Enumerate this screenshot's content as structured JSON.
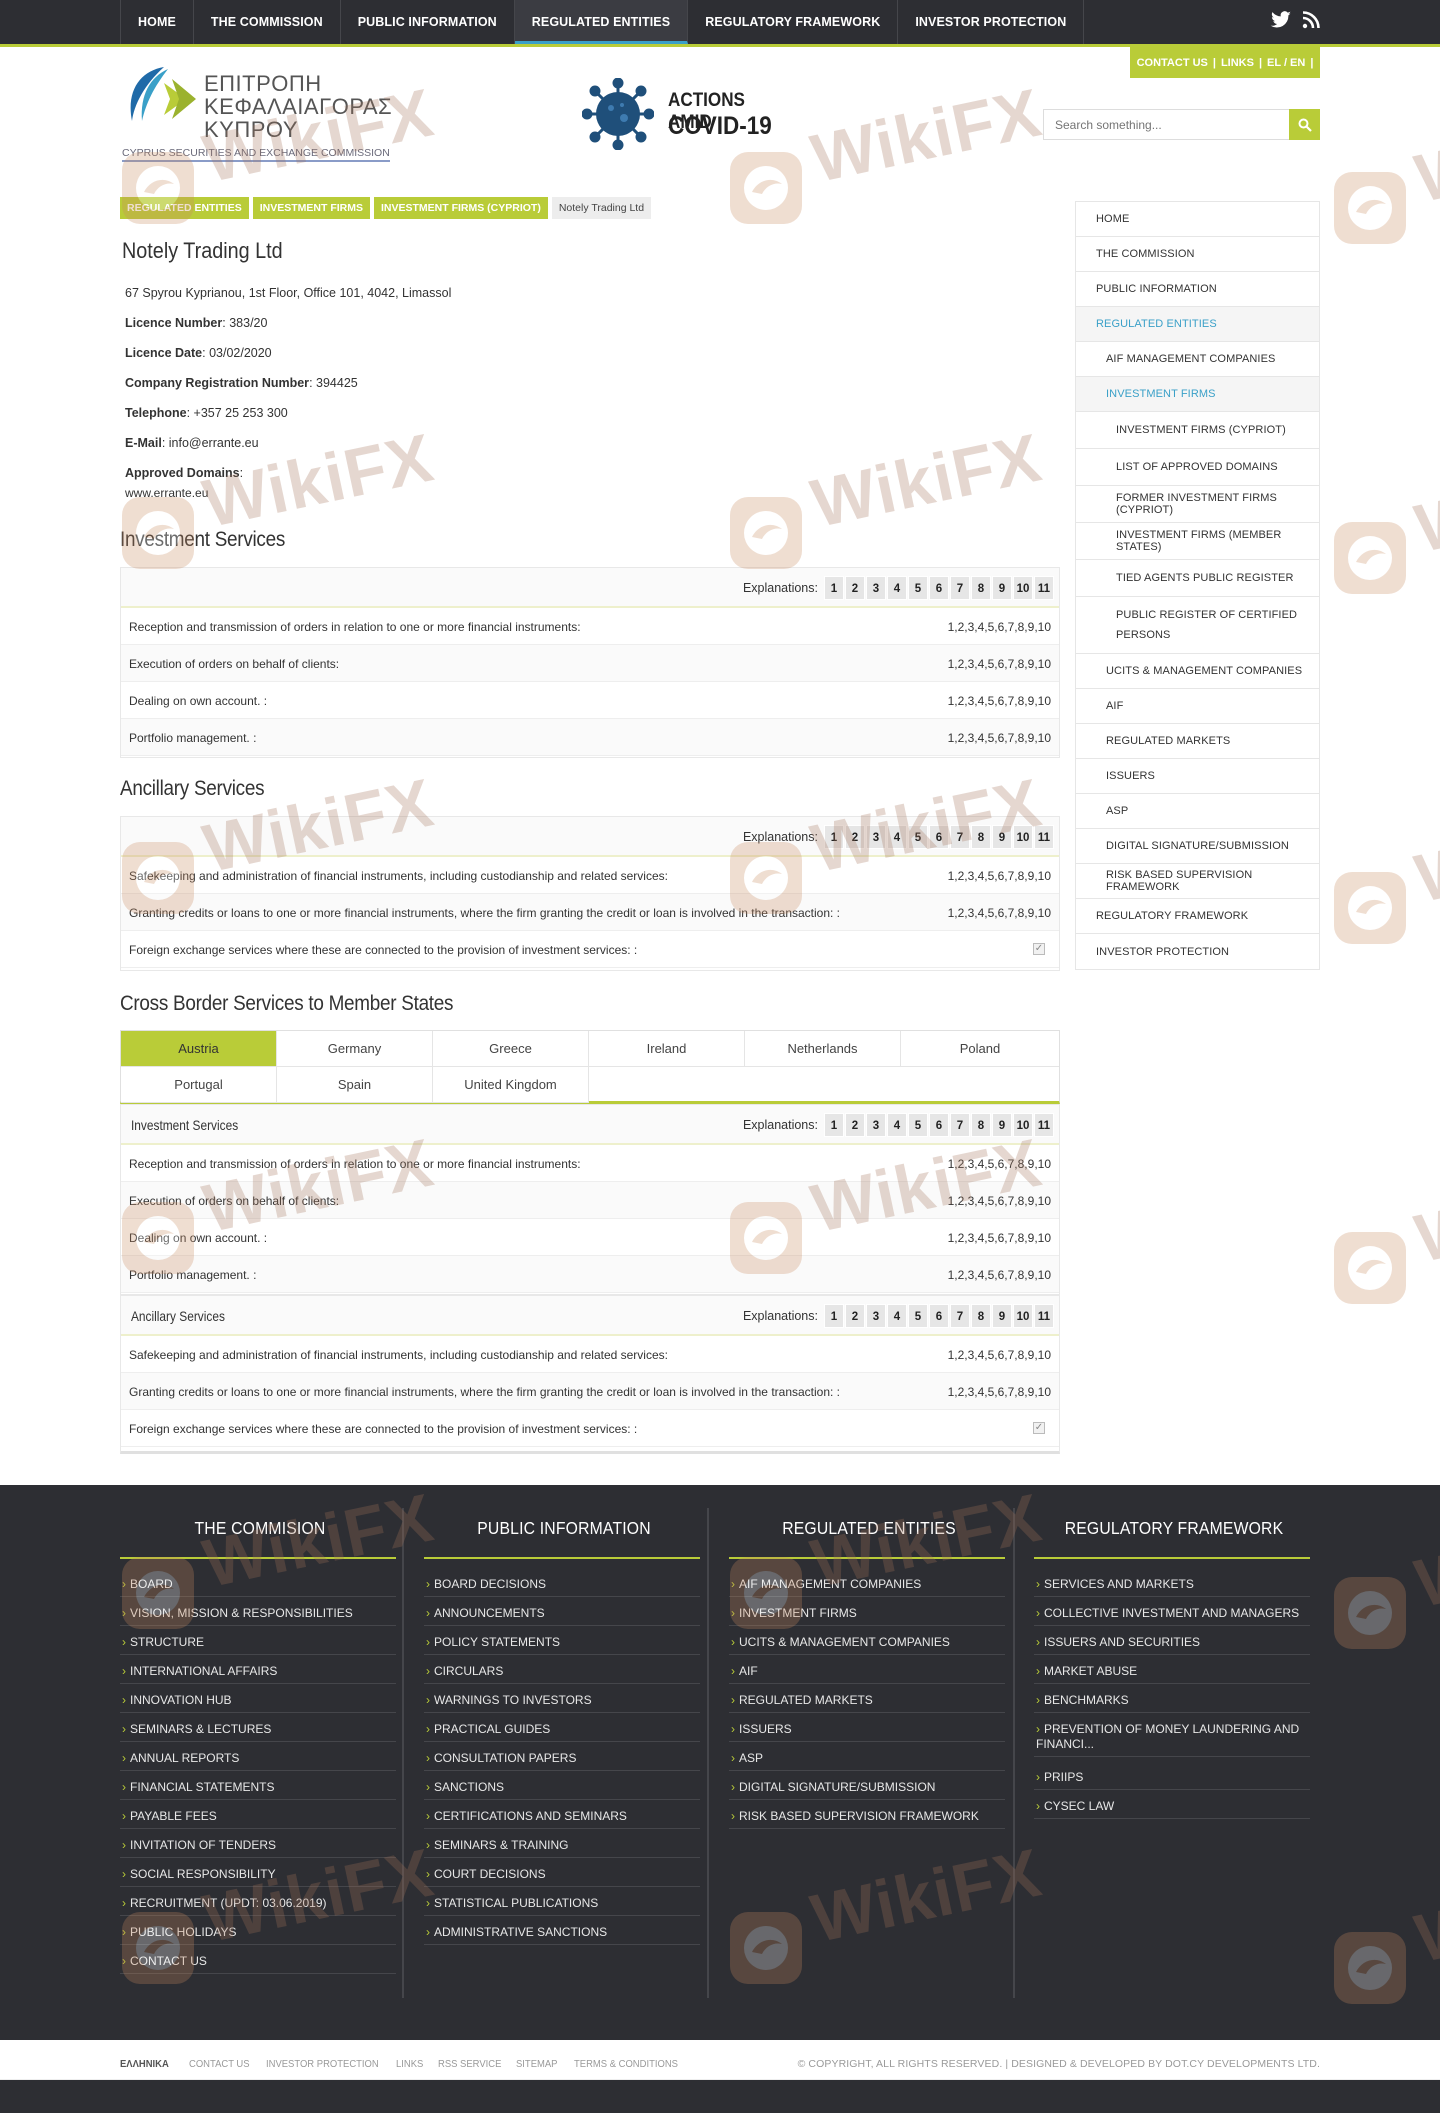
{
  "nav": [
    "HOME",
    "THE COMMISSION",
    "PUBLIC INFORMATION",
    "REGULATED ENTITIES",
    "REGULATORY FRAMEWORK",
    "INVESTOR PROTECTION"
  ],
  "contact_bar": {
    "contact": "CONTACT US",
    "sep1": "|",
    "links": "LINKS",
    "sep2": "|",
    "lang": "EL / EN",
    "sep3": "|"
  },
  "logo": {
    "line1": "ΕΠΙΤΡΟΠΗ",
    "line2": "ΚΕΦΑΛΑΙΑΓΟΡΑΣ",
    "line3": "ΚΥΠΡΟΥ",
    "english": "CYPRUS SECURITIES AND EXCHANGE COMMISSION"
  },
  "covid": {
    "line1": "ACTIONS AMID",
    "line2": "COVID-19"
  },
  "search": {
    "placeholder": "Search something..."
  },
  "breadcrumb": [
    "REGULATED ENTITIES",
    "INVESTMENT FIRMS",
    "INVESTMENT FIRMS (CYPRIOT)",
    "Notely Trading Ltd"
  ],
  "entity": {
    "title": "Notely Trading Ltd",
    "address": "67 Spyrou Kyprianou, 1st Floor, Office 101, 4042, Limassol",
    "licence_number_label": "Licence Number",
    "licence_number": "383/20",
    "licence_date_label": "Licence Date",
    "licence_date": "03/02/2020",
    "crn_label": "Company Registration Number",
    "crn": "394425",
    "phone_label": "Telephone",
    "phone": "+357 25 253 300",
    "email_label": "E-Mail",
    "email": "info@errante.eu",
    "domains_label": "Approved Domains",
    "domains": "www.errante.eu"
  },
  "explanations_label": "Explanations:",
  "explanation_numbers": [
    "1",
    "2",
    "3",
    "4",
    "5",
    "6",
    "7",
    "8",
    "9",
    "10",
    "11"
  ],
  "sections": {
    "investment_title": "Investment Services",
    "ancillary_title": "Ancillary Services",
    "crossborder_title": "Cross Border Services to Member States"
  },
  "investment_services": [
    {
      "label": "Reception and transmission of orders in relation to one or more financial instruments:",
      "value": "1,2,3,4,5,6,7,8,9,10"
    },
    {
      "label": "Execution of orders on behalf of clients:",
      "value": "1,2,3,4,5,6,7,8,9,10"
    },
    {
      "label": "Dealing on own account. :",
      "value": "1,2,3,4,5,6,7,8,9,10"
    },
    {
      "label": "Portfolio management. :",
      "value": "1,2,3,4,5,6,7,8,9,10"
    }
  ],
  "ancillary_services": [
    {
      "label": "Safekeeping and administration of financial instruments, including custodianship and related services:",
      "value": "1,2,3,4,5,6,7,8,9,10"
    },
    {
      "label": "Granting credits or loans to one or more financial instruments, where the firm granting the credit or loan is involved in the transaction: :",
      "value": "1,2,3,4,5,6,7,8,9,10"
    },
    {
      "label": "Foreign exchange services where these are connected to the provision of investment services: :",
      "value": "✓"
    }
  ],
  "countries": [
    "Austria",
    "Germany",
    "Greece",
    "Ireland",
    "Netherlands",
    "Poland",
    "Portugal",
    "Spain",
    "United Kingdom"
  ],
  "sidebar": [
    "HOME",
    "THE COMMISSION",
    "PUBLIC INFORMATION",
    "REGULATED ENTITIES",
    "AIF MANAGEMENT COMPANIES",
    "INVESTMENT FIRMS",
    "INVESTMENT FIRMS (CYPRIOT)",
    "LIST OF APPROVED DOMAINS",
    "FORMER INVESTMENT FIRMS (CYPRIOT)",
    "INVESTMENT FIRMS (MEMBER STATES)",
    "TIED AGENTS PUBLIC REGISTER",
    "PUBLIC REGISTER OF CERTIFIED",
    "PERSONS",
    "UCITS & MANAGEMENT COMPANIES",
    "AIF",
    "REGULATED MARKETS",
    "ISSUERS",
    "ASP",
    "DIGITAL SIGNATURE/SUBMISSION",
    "RISK BASED SUPERVISION FRAMEWORK",
    "REGULATORY FRAMEWORK",
    "INVESTOR PROTECTION"
  ],
  "footer": {
    "col1": {
      "title": "THE COMMISION",
      "items": [
        "BOARD",
        "VISION, MISSION & RESPONSIBILITIES",
        "STRUCTURE",
        "INTERNATIONAL AFFAIRS",
        "INNOVATION HUB",
        "SEMINARS & LECTURES",
        "ANNUAL REPORTS",
        "FINANCIAL STATEMENTS",
        "PAYABLE FEES",
        "INVITATION OF TENDERS",
        "SOCIAL RESPONSIBILITY",
        "RECRUITMENT (UPDT: 03.06.2019)",
        "PUBLIC HOLIDAYS",
        "CONTACT US"
      ]
    },
    "col2": {
      "title": "PUBLIC INFORMATION",
      "items": [
        "BOARD DECISIONS",
        "ANNOUNCEMENTS",
        "POLICY STATEMENTS",
        "CIRCULARS",
        "WARNINGS TO INVESTORS",
        "PRACTICAL GUIDES",
        "CONSULTATION PAPERS",
        "SANCTIONS",
        "CERTIFICATIONS AND SEMINARS",
        "SEMINARS & TRAINING",
        "COURT DECISIONS",
        "STATISTICAL PUBLICATIONS",
        "ADMINISTRATIVE SANCTIONS"
      ]
    },
    "col3": {
      "title": "REGULATED ENTITIES",
      "items": [
        "AIF MANAGEMENT COMPANIES",
        "INVESTMENT FIRMS",
        "UCITS & MANAGEMENT COMPANIES",
        "AIF",
        "REGULATED MARKETS",
        "ISSUERS",
        "ASP",
        "DIGITAL SIGNATURE/SUBMISSION",
        "RISK BASED SUPERVISION FRAMEWORK"
      ]
    },
    "col4": {
      "title": "REGULATORY FRAMEWORK",
      "items": [
        "SERVICES AND MARKETS",
        "COLLECTIVE INVESTMENT AND MANAGERS",
        "ISSUERS AND SECURITIES",
        "MARKET ABUSE",
        "BENCHMARKS",
        "PREVENTION OF MONEY LAUNDERING AND FINANCI...",
        "PRIIPS",
        "CYSEC LAW"
      ]
    }
  },
  "bottom_links": [
    "ΕΛΛΗΝΙΚΑ",
    "CONTACT US",
    "INVESTOR PROTECTION",
    "LINKS",
    "RSS SERVICE",
    "SITEMAP",
    "TERMS & CONDITIONS"
  ],
  "copyright": "© COPYRIGHT, ALL RIGHTS RESERVED. | DESIGNED & DEVELOPED BY DOT.CY DEVELOPMENTS LTD.",
  "watermark": "WikiFX",
  "colors": {
    "accent": "#b9cc38",
    "dark": "#2d2e33",
    "link": "#3aa0c8"
  }
}
